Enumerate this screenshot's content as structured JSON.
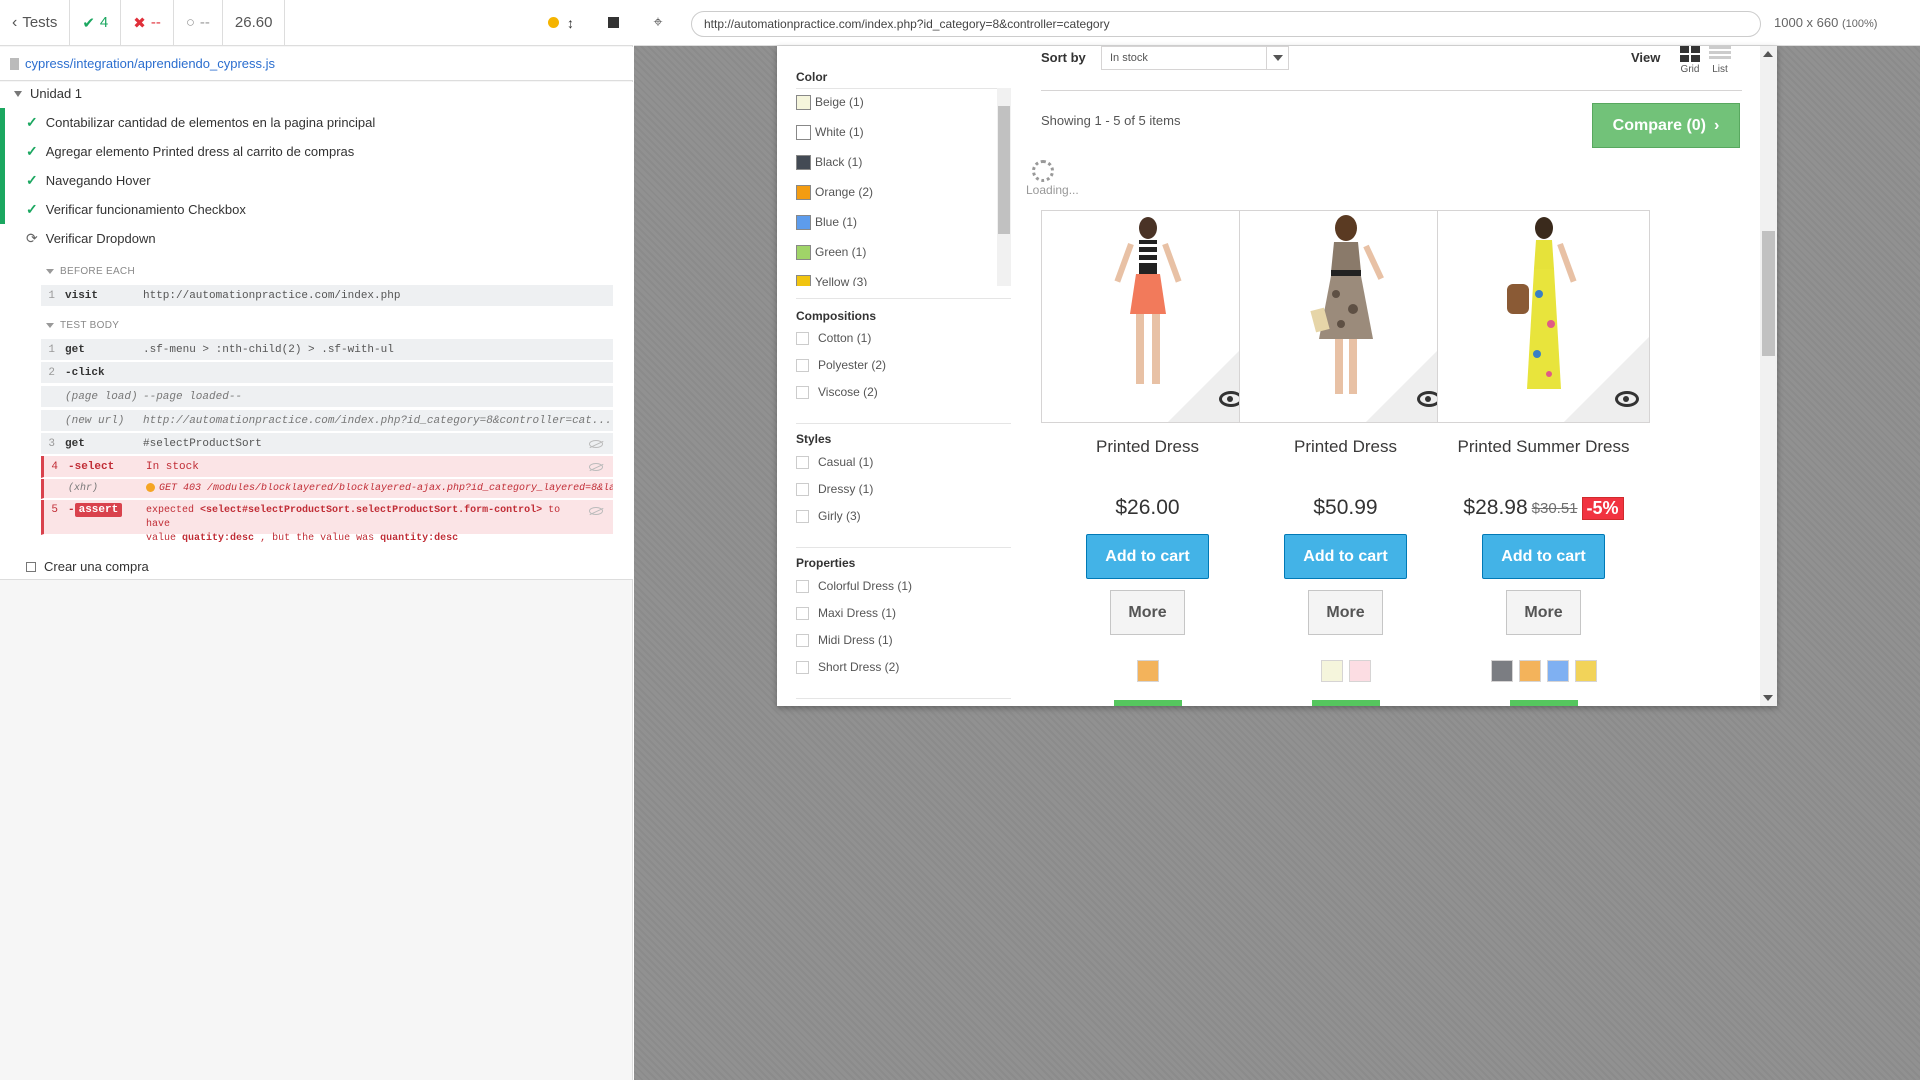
{
  "runner": {
    "tests_button": "Tests",
    "passed": "4",
    "failed": "--",
    "pending": "--",
    "duration": "26.60",
    "spec_file": "cypress/integration/aprendiendo_cypress.js",
    "suite": "Unidad 1",
    "tests": [
      {
        "label": "Contabilizar cantidad de elementos en la pagina principal",
        "state": "passed"
      },
      {
        "label": "Agregar elemento Printed dress al carrito de compras",
        "state": "passed"
      },
      {
        "label": "Navegando Hover",
        "state": "passed"
      },
      {
        "label": "Verificar funcionamiento Checkbox",
        "state": "passed"
      },
      {
        "label": "Verificar Dropdown",
        "state": "running"
      }
    ],
    "pending_test": "Crear una compra",
    "before_each_label": "BEFORE EACH",
    "test_body_label": "TEST BODY",
    "before_each": [
      {
        "num": "1",
        "cmd": "visit",
        "val": "http://automationpractice.com/index.php"
      }
    ],
    "commands": [
      {
        "num": "1",
        "cmd": "get",
        "val": ".sf-menu > :nth-child(2) > .sf-with-ul"
      },
      {
        "num": "2",
        "cmd": "-click",
        "val": ""
      },
      {
        "num": "",
        "cmd": "(page load)",
        "val": "--page loaded--"
      },
      {
        "num": "",
        "cmd": "(new url)",
        "val": "http://automationpractice.com/index.php?id_category=8&controller=cat..."
      },
      {
        "num": "3",
        "cmd": "get",
        "val": "#selectProductSort"
      },
      {
        "num": "4",
        "cmd": "-select",
        "val": "In stock"
      },
      {
        "num": "",
        "cmd": "(xhr)",
        "val": "GET 403 /modules/blocklayered/blocklayered-ajax.php?id_category_layered=8&laye..."
      }
    ],
    "assert": {
      "num": "5",
      "cmd": "assert",
      "line1_a": "expected",
      "line1_b": "<select#selectProductSort.selectProductSort.form-control>",
      "line1_c": "to have",
      "line2_a": "value",
      "line2_b": "quatity:desc",
      "line2_c": ", but the value was",
      "line2_d": "quantity:desc"
    }
  },
  "browser": {
    "url": "http://automationpractice.com/index.php?id_category=8&controller=category",
    "viewport": "1000 x 660",
    "zoom": "(100%)"
  },
  "shop": {
    "color_title": "Color",
    "colors": [
      {
        "label": "Beige (1)",
        "hex": "#f5f5dc"
      },
      {
        "label": "White (1)",
        "hex": "#ffffff"
      },
      {
        "label": "Black (1)",
        "hex": "#434a54"
      },
      {
        "label": "Orange (2)",
        "hex": "#f39c11"
      },
      {
        "label": "Blue (1)",
        "hex": "#5d9cec"
      },
      {
        "label": "Green (1)",
        "hex": "#a0d468"
      },
      {
        "label": "Yellow (3)",
        "hex": "#f1c40f"
      }
    ],
    "compositions_title": "Compositions",
    "compositions": [
      "Cotton (1)",
      "Polyester (2)",
      "Viscose (2)"
    ],
    "styles_title": "Styles",
    "styles": [
      "Casual (1)",
      "Dressy (1)",
      "Girly (3)"
    ],
    "properties_title": "Properties",
    "properties": [
      "Colorful Dress (1)",
      "Maxi Dress (1)",
      "Midi Dress (1)",
      "Short Dress (2)"
    ],
    "sort_label": "Sort by",
    "sort_value": "In stock",
    "view_label": "View",
    "view_grid": "Grid",
    "view_list": "List",
    "showing": "Showing 1 - 5 of 5 items",
    "compare": "Compare (0)",
    "loading": "Loading...",
    "add_to_cart": "Add to cart",
    "more": "More",
    "products": [
      {
        "name": "Printed Dress",
        "price": "$26.00",
        "old_price": "",
        "discount": "",
        "swatches": [
          "#f3b35b"
        ]
      },
      {
        "name": "Printed Dress",
        "price": "$50.99",
        "old_price": "",
        "discount": "",
        "swatches": [
          "#f5f5dc",
          "#fcdde3"
        ]
      },
      {
        "name": "Printed Summer Dress",
        "price": "$28.98",
        "old_price": "$30.51",
        "discount": "-5%",
        "swatches": [
          "#7b7d82",
          "#f3b35b",
          "#7fb0f2",
          "#f2d359"
        ]
      }
    ]
  }
}
